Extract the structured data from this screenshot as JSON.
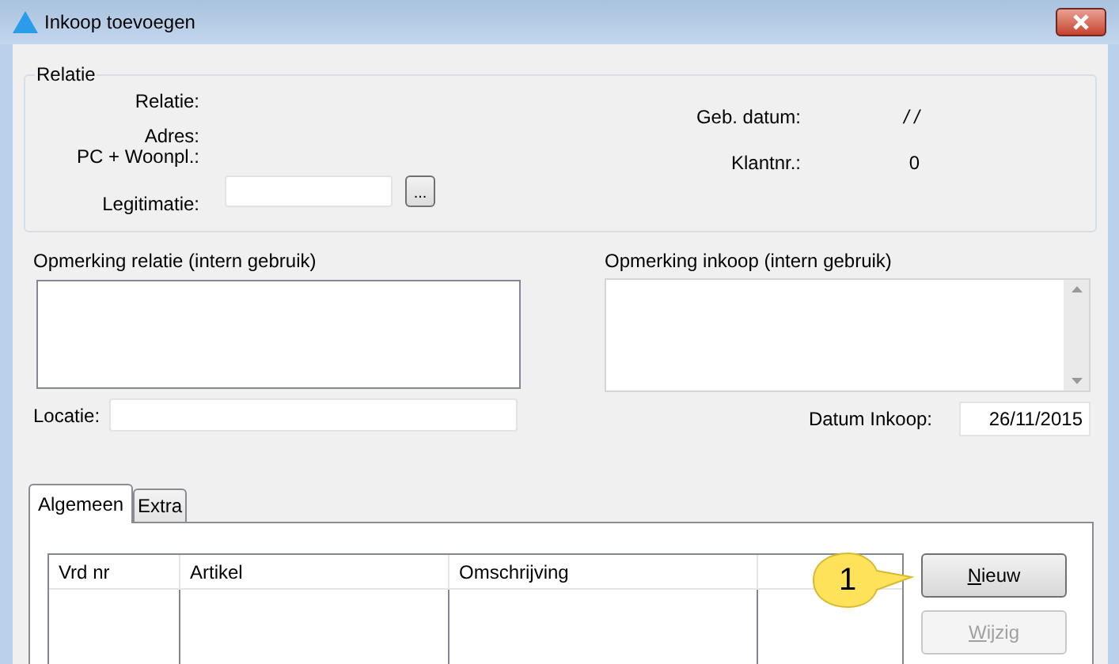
{
  "window": {
    "title": "Inkoop toevoegen"
  },
  "relatie": {
    "title": "Relatie",
    "labels": [
      "Relatie:",
      "Adres:",
      "PC + Woonpl.:"
    ],
    "legitimatie": {
      "label": "Legitimatie:",
      "browse": "..."
    },
    "geb_datum": {
      "label": "Geb. datum:",
      "value": "/ /"
    },
    "klantnr": {
      "label": "Klantnr.:",
      "value": "0"
    }
  },
  "opmerking_relatie": {
    "label": "Opmerking relatie (intern gebruik)"
  },
  "opmerking_inkoop": {
    "label": "Opmerking inkoop (intern gebruik)"
  },
  "locatie": {
    "label": "Locatie:"
  },
  "datum_inkoop": {
    "label": "Datum Inkoop:",
    "value": "26/11/2015"
  },
  "tabs": [
    {
      "label": "Algemeen",
      "selected": true
    },
    {
      "label": "Extra",
      "selected": false
    }
  ],
  "table": {
    "columns": [
      "Vrd nr",
      "Artikel",
      "Omschrijving"
    ]
  },
  "callout": "1",
  "buttons": [
    {
      "label": "Nieuw",
      "disabled": false
    },
    {
      "label": "Wijzig",
      "disabled": true
    }
  ]
}
